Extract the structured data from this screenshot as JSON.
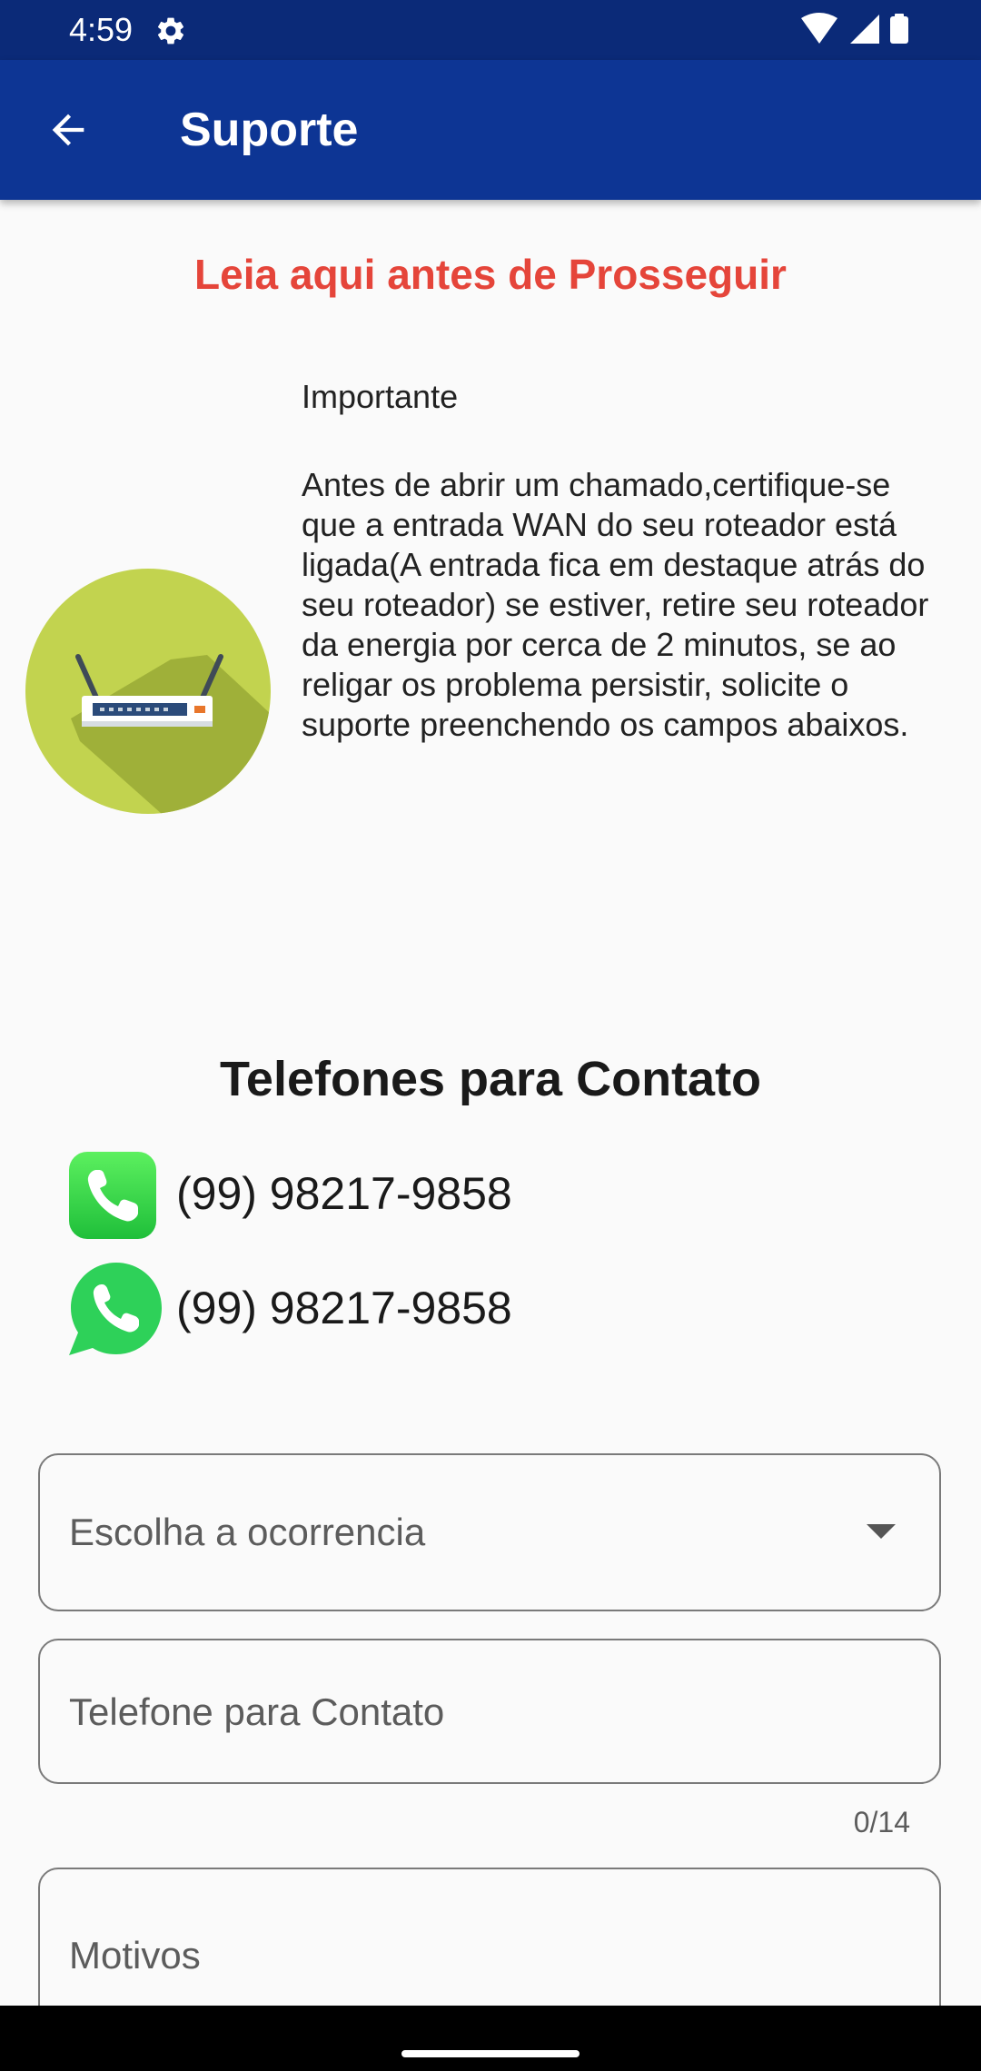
{
  "status_bar": {
    "time": "4:59",
    "icons": [
      "gear-icon",
      "wifi-icon",
      "signal-icon",
      "battery-icon"
    ],
    "background": "#0b2a78"
  },
  "app_bar": {
    "title": "Suporte",
    "back_icon": "arrow-left-icon",
    "background": "#0d3594"
  },
  "notice": {
    "title": "Leia aqui antes de Prosseguir",
    "title_color": "#e5453a",
    "illustration": "router-icon",
    "heading": "Importante",
    "body": "Antes de abrir um chamado,certifique-se que a entrada WAN do seu roteador está ligada(A entrada fica em destaque atrás do seu roteador) se estiver, retire seu roteador da energia por cerca de 2 minutos, se ao religar os problema persistir, solicite o suporte preenchendo os campos abaixos."
  },
  "contacts": {
    "title": "Telefones para Contato",
    "items": [
      {
        "icon": "phone-icon",
        "number": "(99) 98217-9858"
      },
      {
        "icon": "whatsapp-icon",
        "number": "(99) 98217-9858"
      }
    ]
  },
  "form": {
    "occurrence": {
      "placeholder": "Escolha a ocorrencia",
      "icon": "dropdown-arrow-icon"
    },
    "phone": {
      "placeholder": "Telefone para Contato",
      "counter": "0/14"
    },
    "reasons": {
      "placeholder": "Motivos"
    }
  }
}
